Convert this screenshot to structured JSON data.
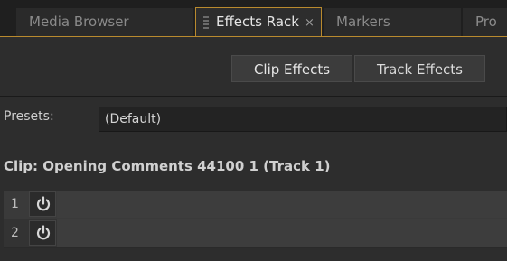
{
  "tabs": [
    {
      "label": "Media Browser"
    },
    {
      "label": "Effects Rack",
      "close": "×"
    },
    {
      "label": "Markers"
    },
    {
      "label": "Pro"
    }
  ],
  "segmented": {
    "clip_effects": "Clip Effects",
    "track_effects": "Track Effects"
  },
  "presets": {
    "label": "Presets:",
    "value": "(Default)"
  },
  "clip": {
    "title": "Clip: Opening Comments 44100 1 (Track 1)"
  },
  "rack_slots": [
    {
      "number": "1"
    },
    {
      "number": "2"
    }
  ],
  "colors": {
    "accent": "#b98a2e",
    "power_icon": "#d8d8d8"
  },
  "icons": {
    "power": "power-icon",
    "grip": "grip-icon"
  }
}
